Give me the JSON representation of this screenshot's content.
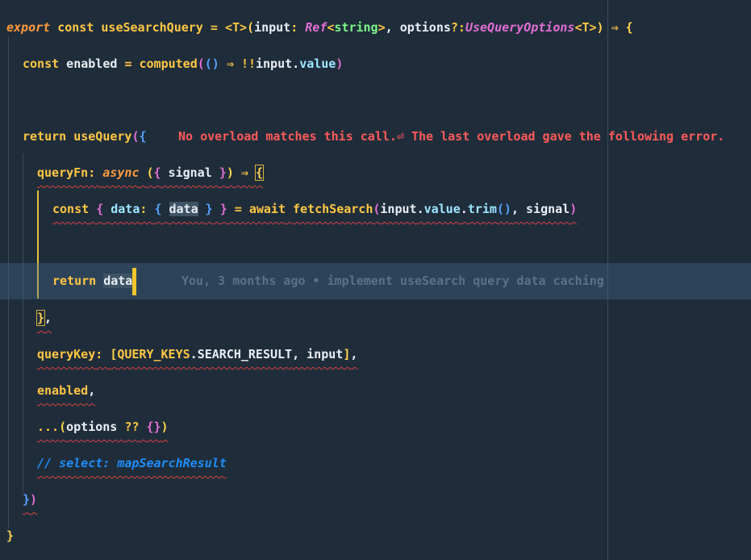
{
  "editor": {
    "lines": [
      {
        "tokens": [
          {
            "t": "export",
            "c": "kw-it"
          },
          {
            "t": " ",
            "c": "var"
          },
          {
            "t": "const",
            "c": "kw"
          },
          {
            "t": " ",
            "c": "var"
          },
          {
            "t": "useSearchQuery",
            "c": "fn"
          },
          {
            "t": " = ",
            "c": "op"
          },
          {
            "t": "<T>",
            "c": "op"
          },
          {
            "t": "(",
            "c": "p1"
          },
          {
            "t": "input",
            "c": "var"
          },
          {
            "t": ": ",
            "c": "op"
          },
          {
            "t": "Ref",
            "c": "type"
          },
          {
            "t": "<",
            "c": "op"
          },
          {
            "t": "string",
            "c": "typed"
          },
          {
            "t": ">",
            "c": "op"
          },
          {
            "t": ", ",
            "c": "var"
          },
          {
            "t": "options",
            "c": "var"
          },
          {
            "t": "?:",
            "c": "op"
          },
          {
            "t": "UseQueryOptions",
            "c": "type"
          },
          {
            "t": "<T>",
            "c": "op"
          },
          {
            "t": ")",
            "c": "p1"
          },
          {
            "t": " ⇒ ",
            "c": "op"
          },
          {
            "t": "{",
            "c": "p1"
          }
        ]
      },
      {
        "tokens": [
          {
            "t": "const",
            "c": "kw"
          },
          {
            "t": " enabled ",
            "c": "var"
          },
          {
            "t": "=",
            "c": "op"
          },
          {
            "t": " ",
            "c": "var"
          },
          {
            "t": "computed",
            "c": "fn"
          },
          {
            "t": "(",
            "c": "p2"
          },
          {
            "t": "()",
            "c": "p3"
          },
          {
            "t": " ⇒ ",
            "c": "op"
          },
          {
            "t": "!!",
            "c": "op"
          },
          {
            "t": "input",
            "c": "var"
          },
          {
            "t": ".",
            "c": "var"
          },
          {
            "t": "value",
            "c": "prop"
          },
          {
            "t": ")",
            "c": "p2"
          }
        ]
      },
      {
        "tokens": []
      },
      {
        "tokens": [
          {
            "t": "return",
            "c": "kw"
          },
          {
            "t": " ",
            "c": "var"
          },
          {
            "t": "useQuery",
            "c": "fn"
          },
          {
            "t": "(",
            "c": "p2"
          },
          {
            "t": "{",
            "c": "p3"
          }
        ]
      },
      {
        "tokens": [
          {
            "t": "queryFn",
            "c": "fn"
          },
          {
            "t": ": ",
            "c": "op"
          },
          {
            "t": "async",
            "c": "kw-it"
          },
          {
            "t": " ",
            "c": "var"
          },
          {
            "t": "(",
            "c": "p1"
          },
          {
            "t": "{",
            "c": "p2"
          },
          {
            "t": " signal ",
            "c": "var"
          },
          {
            "t": "}",
            "c": "p2"
          },
          {
            "t": ")",
            "c": "p1"
          },
          {
            "t": " ⇒ ",
            "c": "op"
          },
          {
            "t": "{",
            "c": "p1"
          }
        ]
      },
      {
        "tokens": [
          {
            "t": "const",
            "c": "kw"
          },
          {
            "t": " ",
            "c": "var"
          },
          {
            "t": "{",
            "c": "p2"
          },
          {
            "t": " ",
            "c": "var"
          },
          {
            "t": "data",
            "c": "prop"
          },
          {
            "t": ": ",
            "c": "op"
          },
          {
            "t": "{",
            "c": "p3"
          },
          {
            "t": " ",
            "c": "var"
          },
          {
            "t": "data",
            "c": "var"
          },
          {
            "t": " ",
            "c": "var"
          },
          {
            "t": "}",
            "c": "p3"
          },
          {
            "t": " ",
            "c": "var"
          },
          {
            "t": "}",
            "c": "p2"
          },
          {
            "t": " = ",
            "c": "op"
          },
          {
            "t": "await",
            "c": "kw"
          },
          {
            "t": " ",
            "c": "var"
          },
          {
            "t": "fetchSearch",
            "c": "fn"
          },
          {
            "t": "(",
            "c": "p2"
          },
          {
            "t": "input",
            "c": "var"
          },
          {
            "t": ".",
            "c": "var"
          },
          {
            "t": "value",
            "c": "prop"
          },
          {
            "t": ".",
            "c": "var"
          },
          {
            "t": "trim",
            "c": "prop"
          },
          {
            "t": "()",
            "c": "p3"
          },
          {
            "t": ", signal",
            "c": "var"
          },
          {
            "t": ")",
            "c": "p2"
          }
        ]
      },
      {
        "tokens": []
      },
      {
        "tokens": [
          {
            "t": "return",
            "c": "kw"
          },
          {
            "t": " ",
            "c": "var"
          },
          {
            "t": "data",
            "c": "var"
          }
        ]
      },
      {
        "tokens": [
          {
            "t": "}",
            "c": "p1"
          },
          {
            "t": ",",
            "c": "var"
          }
        ]
      },
      {
        "tokens": [
          {
            "t": "queryKey",
            "c": "fn"
          },
          {
            "t": ": ",
            "c": "op"
          },
          {
            "t": "[",
            "c": "p1"
          },
          {
            "t": "QUERY_KEYS",
            "c": "kw"
          },
          {
            "t": ".",
            "c": "var"
          },
          {
            "t": "SEARCH_RESULT",
            "c": "var"
          },
          {
            "t": ", input",
            "c": "var"
          },
          {
            "t": "]",
            "c": "p1"
          },
          {
            "t": ",",
            "c": "var"
          }
        ]
      },
      {
        "tokens": [
          {
            "t": "enabled",
            "c": "fn"
          },
          {
            "t": ",",
            "c": "var"
          }
        ]
      },
      {
        "tokens": [
          {
            "t": "...",
            "c": "op"
          },
          {
            "t": "(",
            "c": "p1"
          },
          {
            "t": "options ",
            "c": "var"
          },
          {
            "t": "??",
            "c": "op"
          },
          {
            "t": " ",
            "c": "var"
          },
          {
            "t": "{}",
            "c": "p2"
          },
          {
            "t": ")",
            "c": "p1"
          }
        ]
      },
      {
        "tokens": [
          {
            "t": "// select: mapSearchResult",
            "c": "comment"
          }
        ]
      },
      {
        "tokens": [
          {
            "t": "}",
            "c": "p3"
          },
          {
            "t": ")",
            "c": "p2"
          }
        ]
      },
      {
        "tokens": [
          {
            "t": "}",
            "c": "p1"
          }
        ]
      }
    ],
    "error_message": "No overload matches this call.⏎ The last overload gave the following error.",
    "blame": "You, 3 months ago • implement useSearch query data caching"
  }
}
